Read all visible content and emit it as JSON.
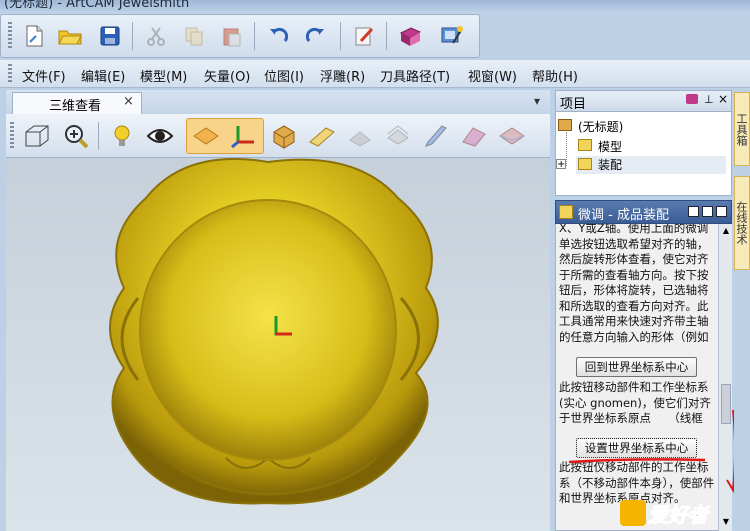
{
  "window": {
    "title": "(无标题) - ArtCAM Jewelsmith"
  },
  "toolbar": {
    "buttons": [
      "new-file-icon",
      "open-folder-icon",
      "save-icon",
      "cut-icon",
      "copy-icon",
      "paste-icon",
      "undo-icon",
      "redo-icon",
      "notes-icon",
      "book-icon",
      "wizard-icon"
    ]
  },
  "menu": {
    "items": [
      "文件(F)",
      "编辑(E)",
      "模型(M)",
      "矢量(O)",
      "位图(I)",
      "浮雕(R)",
      "刀具路径(T)",
      "视窗(W)",
      "帮助(H)"
    ]
  },
  "document": {
    "tab_label": "三维查看",
    "tab_close": "×",
    "tab_menu_glyph": "▾"
  },
  "project_panel": {
    "title": "项目",
    "tree": [
      {
        "label": "(无标题)",
        "expander": ""
      },
      {
        "label": "模型",
        "expander": ""
      },
      {
        "label": "装配",
        "expander": "+"
      }
    ]
  },
  "fine_panel": {
    "title": "微调 - 成品装配",
    "para1": "X、Y或Z轴。使用上面的微调单选按钮选取希望对齐的轴，然后旋转形体查看，使它对齐于所需的查看轴方向。按下按钮后，形体将旋转，已选轴将和所选取的查看方向对齐。此工具通常用来快速对齐带主轴的任意方向输入的形体（例如来自扫描数据的网格形体），以便于加工或渲染。",
    "button1": "回到世界坐标系中心",
    "para2": "此按钮移动部件和工作坐标系(实心 gnomen)，使它们对齐于世界坐标系原点　　（线框 gnomen)。",
    "button2": "设置世界坐标系中心",
    "para3": "此按钮仅移动部件的工作坐标系（不移动部件本身），使部件和世界坐标系原点对齐。"
  },
  "side_tabs": [
    "工具箱",
    "在线技术"
  ],
  "watermark": {
    "text": "爱好者"
  },
  "colors": {
    "accent": "#3a5d96",
    "model_gold": "#d9c21c",
    "annotation_red": "#e01818"
  }
}
